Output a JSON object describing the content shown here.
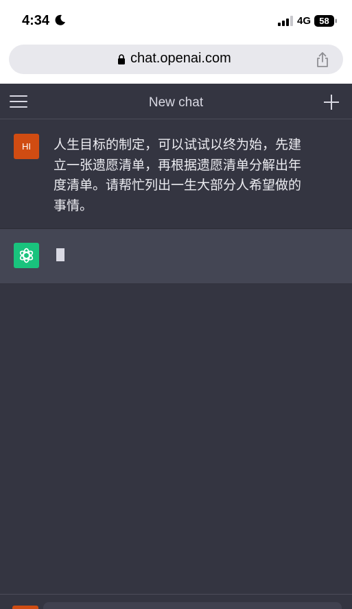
{
  "status_bar": {
    "time": "4:34",
    "network": "4G",
    "battery": "58"
  },
  "browser": {
    "url": "chat.openai.com"
  },
  "header": {
    "title": "New chat"
  },
  "conversation": {
    "user_avatar": "HI",
    "user_message": "人生目标的制定，可以试试以终为始，先建立一张遗愿清单，再根据遗愿清单分解出年度清单。请帮忙列出一生大部分人希望做的事情。"
  },
  "colors": {
    "background": "#343541",
    "assistant_row": "#444654",
    "user_avatar": "#d04c12",
    "assistant_avatar": "#19c37d"
  }
}
